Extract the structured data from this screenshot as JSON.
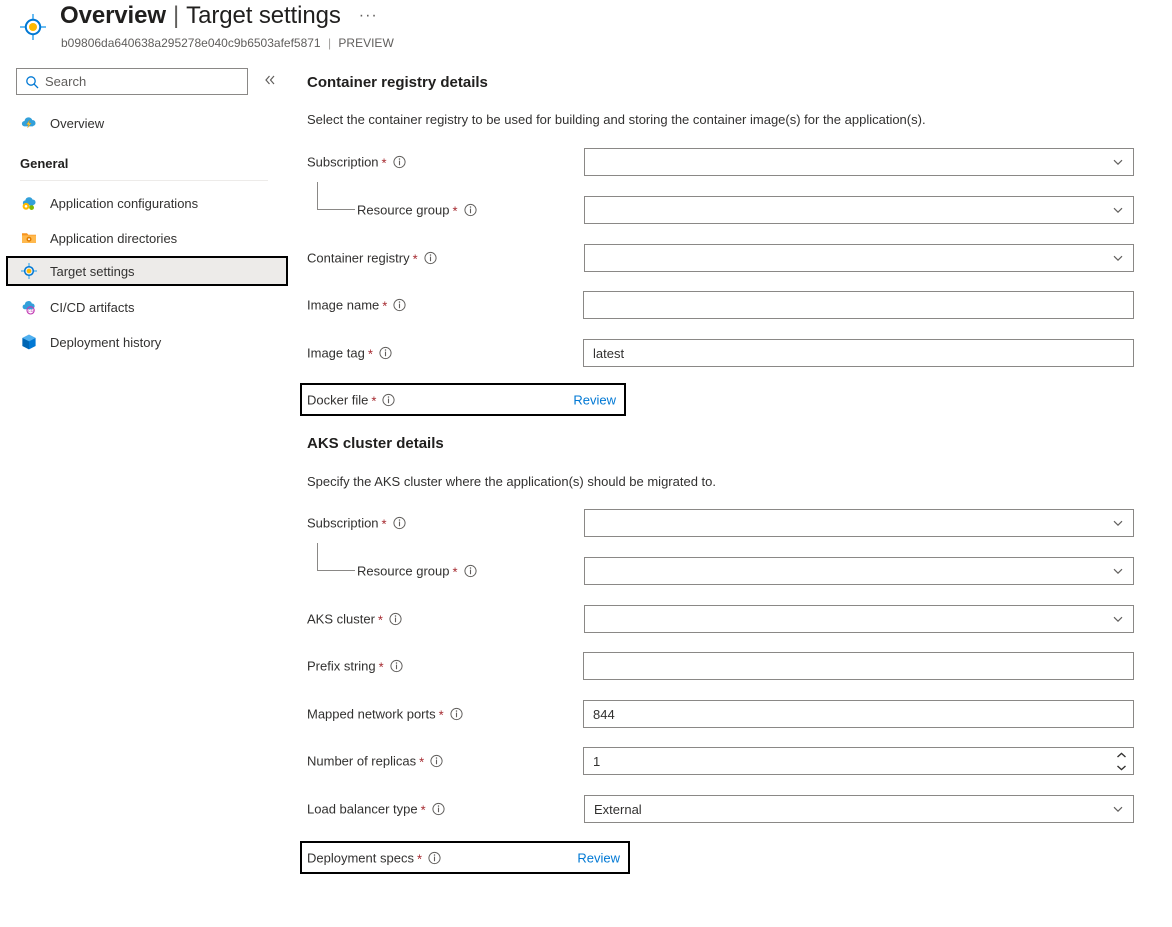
{
  "header": {
    "icon": "target-crosshair-icon",
    "title_main": "Overview",
    "title_separator": "|",
    "title_sub": "Target settings",
    "ellipsis": "···",
    "resource_id": "b09806da640638a295278e040c9b6503afef5871",
    "preview_separator": "|",
    "preview_badge": "PREVIEW"
  },
  "sidebar": {
    "search": {
      "placeholder": "Search",
      "value": "",
      "icon": "search-icon"
    },
    "collapse_icon": "chevron-double-left-icon",
    "top_items": [
      {
        "label": "Overview",
        "icon": "cloud-lightning-icon",
        "selected": false
      }
    ],
    "group_label": "General",
    "items": [
      {
        "label": "Application configurations",
        "icon": "cloud-gear-icon",
        "selected": false
      },
      {
        "label": "Application directories",
        "icon": "folder-gear-icon",
        "selected": false
      },
      {
        "label": "Target settings",
        "icon": "target-crosshair-icon",
        "selected": true
      },
      {
        "label": "CI/CD artifacts",
        "icon": "cloud-pipeline-icon",
        "selected": false
      },
      {
        "label": "Deployment history",
        "icon": "cube-icon",
        "selected": false
      }
    ]
  },
  "main": {
    "sections": [
      {
        "heading": "Container registry details",
        "description": "Select the container registry to be used for building and storing the container image(s) for the application(s).",
        "fields": [
          {
            "label": "Subscription",
            "required": true,
            "info_icon": "info-icon",
            "control": "dropdown",
            "value": "",
            "indented": false
          },
          {
            "label": "Resource group",
            "required": true,
            "info_icon": "info-icon",
            "control": "dropdown",
            "value": "",
            "indented": true
          },
          {
            "label": "Container registry",
            "required": true,
            "info_icon": "info-icon",
            "control": "dropdown",
            "value": "",
            "indented": false
          },
          {
            "label": "Image name",
            "required": true,
            "info_icon": "info-icon",
            "control": "text",
            "value": "",
            "indented": false
          },
          {
            "label": "Image tag",
            "required": true,
            "info_icon": "info-icon",
            "control": "text",
            "value": "latest",
            "indented": false
          },
          {
            "label": "Docker file",
            "required": true,
            "info_icon": "info-icon",
            "control": "review",
            "link_label": "Review",
            "focused": true,
            "indented": false
          }
        ]
      },
      {
        "heading": "AKS cluster details",
        "description": "Specify the AKS cluster where the application(s) should be migrated to.",
        "fields": [
          {
            "label": "Subscription",
            "required": true,
            "info_icon": "info-icon",
            "control": "dropdown",
            "value": "",
            "indented": false
          },
          {
            "label": "Resource group",
            "required": true,
            "info_icon": "info-icon",
            "control": "dropdown",
            "value": "",
            "indented": true
          },
          {
            "label": "AKS cluster",
            "required": true,
            "info_icon": "info-icon",
            "control": "dropdown",
            "value": "",
            "indented": false
          },
          {
            "label": "Prefix string",
            "required": true,
            "info_icon": "info-icon",
            "control": "text",
            "value": "",
            "indented": false
          },
          {
            "label": "Mapped network ports",
            "required": true,
            "info_icon": "info-icon",
            "control": "text",
            "value": "844",
            "indented": false
          },
          {
            "label": "Number of replicas",
            "required": true,
            "info_icon": "info-icon",
            "control": "spinner",
            "value": "1",
            "indented": false
          },
          {
            "label": "Load balancer type",
            "required": true,
            "info_icon": "info-icon",
            "control": "dropdown",
            "value": "External",
            "indented": false
          },
          {
            "label": "Deployment specs",
            "required": true,
            "info_icon": "info-icon",
            "control": "review",
            "link_label": "Review",
            "focused": true,
            "indented": false
          }
        ]
      }
    ]
  },
  "colors": {
    "accent": "#0078d4",
    "required_star": "#a4262c",
    "border": "#8a8886",
    "selected_bg": "#edebe9",
    "focus_outline": "#000000",
    "text": "#323130"
  }
}
